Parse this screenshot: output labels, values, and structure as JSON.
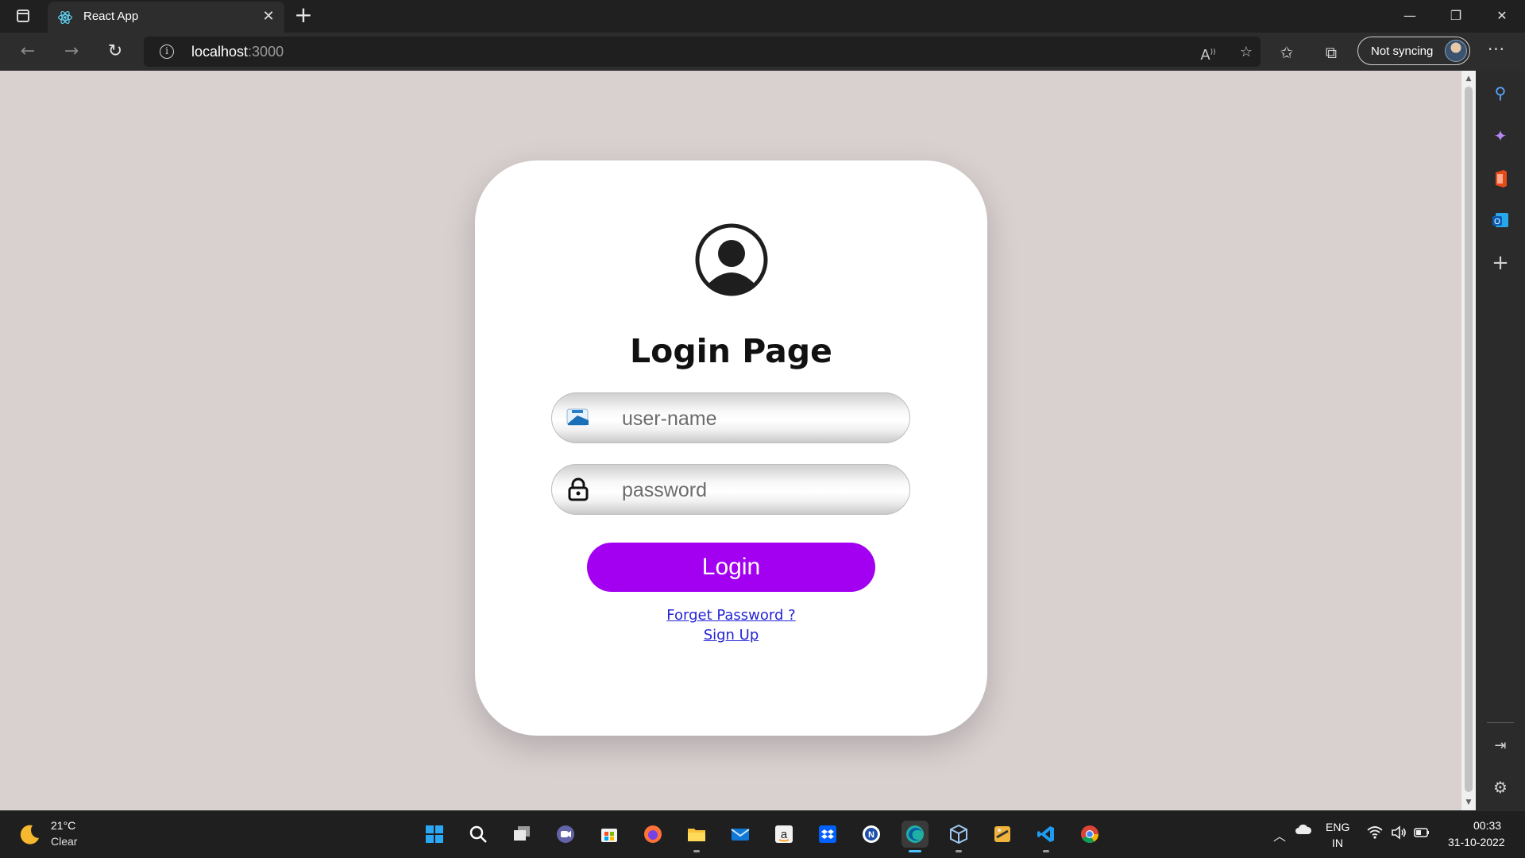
{
  "browser": {
    "tab_title": "React App",
    "url_host": "localhost",
    "url_port": ":3000",
    "profile_status": "Not syncing"
  },
  "page": {
    "title": "Login Page",
    "username_placeholder": "user-name",
    "password_placeholder": "password",
    "login_label": "Login",
    "forget_link": "Forget Password ?",
    "signup_link": "Sign Up",
    "background_color": "#d9d0d0",
    "button_color": "#a300f2",
    "link_color": "#2424d6"
  },
  "sidebar": {
    "icons": [
      "search-icon",
      "copilot-icon",
      "office-icon",
      "outlook-icon",
      "add-icon",
      "split-screen-icon",
      "settings-icon"
    ]
  },
  "taskbar": {
    "weather_temp": "21°C",
    "weather_desc": "Clear",
    "apps": [
      "start",
      "search",
      "task-view",
      "teams-chat",
      "microsoft-store",
      "firefox",
      "file-explorer",
      "mail",
      "amazon",
      "dropbox",
      "app-n",
      "edge",
      "virtualbox",
      "sublime",
      "vscode",
      "chrome"
    ],
    "active_app": "edge",
    "lang_line1": "ENG",
    "lang_line2": "IN",
    "time": "00:33",
    "date": "31-10-2022"
  }
}
